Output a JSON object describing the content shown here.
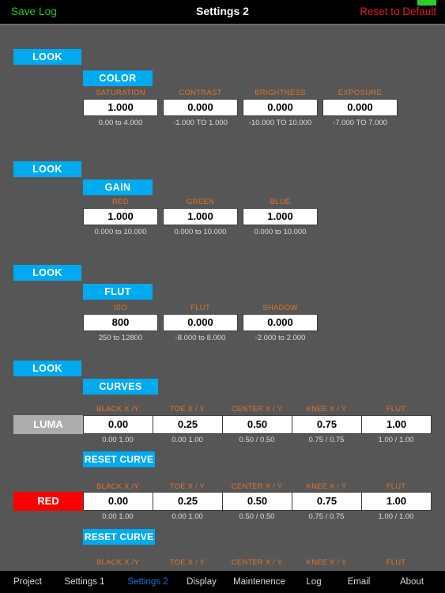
{
  "topbar": {
    "save_log": "Save Log",
    "title": "Settings 2",
    "reset_to_default": "Reset to Default",
    "status_chip_color": "#2ecc2e"
  },
  "colors": {
    "background": "#565656",
    "accent_blue": "#00aaf0",
    "label_orange": "#e0752b",
    "red": "#fb0000",
    "luma_gray": "#adadad",
    "save_green": "#22cc22",
    "reset_red": "#e02020",
    "tab_active": "#1f6fe0"
  },
  "sections": [
    {
      "look_label": "LOOK",
      "mode_label": "COLOR",
      "fields": [
        {
          "label": "SATURATION",
          "value": "1.000",
          "range": "0.00 to 4.000"
        },
        {
          "label": "CONTRAST",
          "value": "0.000",
          "range": "-1.000 TO 1.000"
        },
        {
          "label": "BRIGHTNESS",
          "value": "0.000",
          "range": "-10.000 TO 10.000"
        },
        {
          "label": "EXPOSURE",
          "value": "0.000",
          "range": "-7.000 TO 7.000"
        }
      ]
    },
    {
      "look_label": "LOOK",
      "mode_label": "GAIN",
      "fields": [
        {
          "label": "RED",
          "value": "1.000",
          "range": "0.000 to 10.000"
        },
        {
          "label": "GREEN",
          "value": "1.000",
          "range": "0.000 to 10.000"
        },
        {
          "label": "BLUE",
          "value": "1.000",
          "range": "0.000 to 10.000"
        }
      ]
    },
    {
      "look_label": "LOOK",
      "mode_label": "FLUT",
      "fields": [
        {
          "label": "ISO",
          "value": "800",
          "range": "250 to 12800"
        },
        {
          "label": "FLUT",
          "value": "0.000",
          "range": "-8.000 to 8.000"
        },
        {
          "label": "SHADOW",
          "value": "0.000",
          "range": "-2.000 to 2.000"
        }
      ]
    }
  ],
  "curves": {
    "look_label": "LOOK",
    "mode_label": "CURVES",
    "column_labels": [
      "BLACK X /Y",
      "TOE X / Y",
      "CENTER X / Y",
      "KNEE X / Y",
      "FLUT"
    ],
    "reset_label": "RESET CURVE",
    "rows": [
      {
        "channel": "LUMA",
        "values": [
          "0.00",
          "0.25",
          "0.50",
          "0.75",
          "1.00"
        ],
        "subvalues": [
          "0.00 1.00",
          "0.00  1.00",
          "0.50 / 0.50",
          "0.75 / 0.75",
          "1.00 / 1.00"
        ]
      },
      {
        "channel": "RED",
        "values": [
          "0.00",
          "0.25",
          "0.50",
          "0.75",
          "1.00"
        ],
        "subvalues": [
          "0.00 1.00",
          "0.00  1.00",
          "0.50 / 0.50",
          "0.75 / 0.75",
          "1.00 / 1.00"
        ]
      }
    ],
    "partial_row_labels": [
      "BLACK X /Y",
      "TOE X / Y",
      "CENTER X / Y",
      "KNEE X / Y",
      "FLUT"
    ]
  },
  "tabbar": {
    "active_index": 2,
    "items": [
      {
        "label": "Project"
      },
      {
        "label": "Settings 1"
      },
      {
        "label": "Settings 2"
      },
      {
        "label": "Display"
      },
      {
        "label": "Maintenence"
      },
      {
        "label": "Log"
      },
      {
        "label": "Email"
      },
      {
        "label": "About"
      }
    ]
  }
}
